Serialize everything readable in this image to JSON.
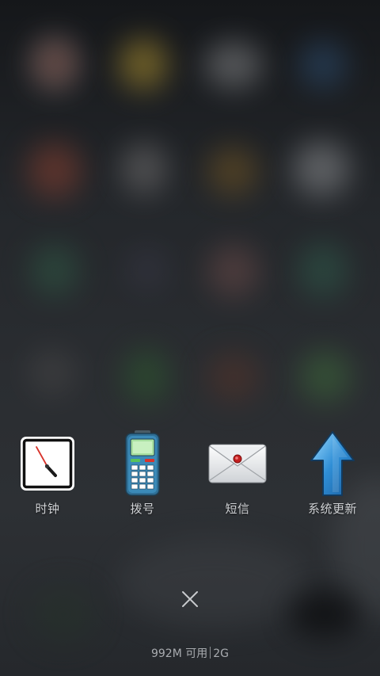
{
  "recent_apps": [
    {
      "label": "时钟",
      "icon": "clock-icon"
    },
    {
      "label": "拨号",
      "icon": "phone-dialer-icon"
    },
    {
      "label": "短信",
      "icon": "envelope-icon"
    },
    {
      "label": "系统更新",
      "icon": "up-arrow-icon"
    }
  ],
  "close_button": {
    "icon": "close-icon"
  },
  "memory": {
    "available": "992M 可用",
    "total": "2G"
  },
  "colors": {
    "label_text": "#cfd1d4",
    "memory_text": "#a9acb0",
    "background": "#2a2d31"
  }
}
